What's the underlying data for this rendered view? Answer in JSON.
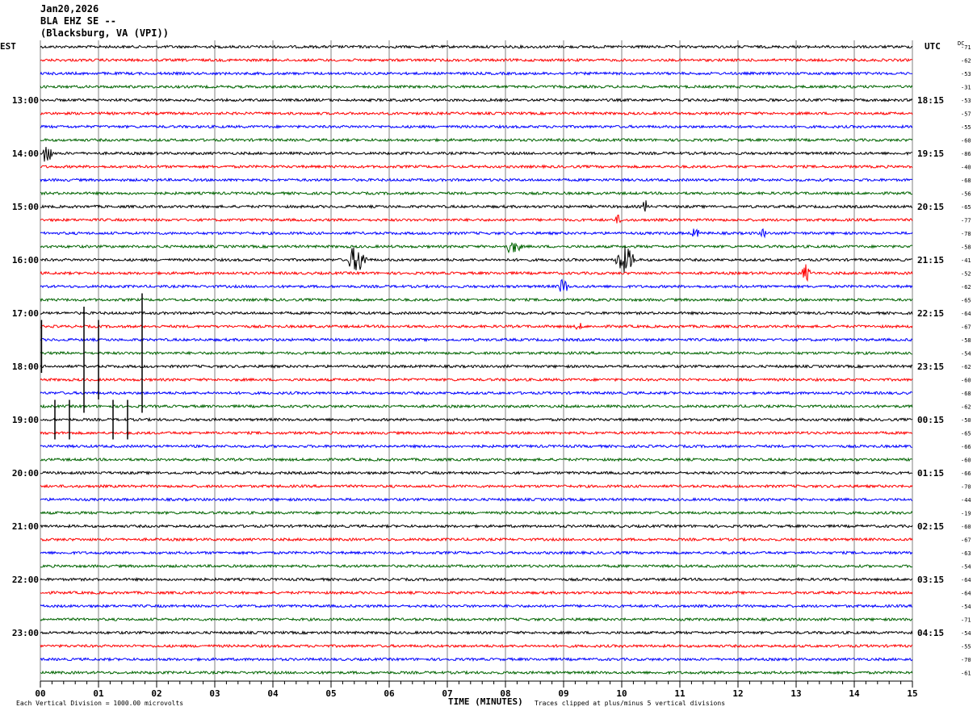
{
  "header": {
    "date": "Jan20,2026",
    "station": "BLA EHZ SE --",
    "location": "(Blacksburg, VA (VPI))"
  },
  "chart_data": {
    "type": "line",
    "subtype": "helicorder",
    "left_axis_label": "EST",
    "right_axis_label": "UTC",
    "dc_label": "DC",
    "xlabel": "TIME (MINUTES)",
    "xlim": [
      0,
      15
    ],
    "x_ticks": [
      "00",
      "01",
      "02",
      "03",
      "04",
      "05",
      "06",
      "07",
      "08",
      "09",
      "10",
      "11",
      "12",
      "13",
      "14",
      "15"
    ],
    "rows_per_hour": 4,
    "trace_colors": [
      "#000000",
      "#ff0000",
      "#0000ff",
      "#006400"
    ],
    "grid_color": "#808080",
    "est_labels": [
      "13:00",
      "14:00",
      "15:00",
      "16:00",
      "17:00",
      "18:00",
      "19:00",
      "20:00",
      "21:00",
      "22:00",
      "23:00"
    ],
    "utc_labels": [
      "18:15",
      "19:15",
      "20:15",
      "21:15",
      "22:15",
      "23:15",
      "00:15",
      "01:15",
      "02:15",
      "03:15",
      "04:15"
    ],
    "dc_offsets": [
      -71,
      -62,
      -53,
      -31,
      -53,
      -57,
      -55,
      -60,
      -86,
      -40,
      -68,
      -56,
      -65,
      -77,
      -78,
      -58,
      -41,
      -52,
      -62,
      -65,
      -64,
      -67,
      -58,
      -54,
      -62,
      -60,
      -68,
      -62,
      -50,
      -65,
      -66,
      -60,
      -66,
      -70,
      -44,
      -19,
      -60,
      -67,
      -63,
      -54,
      -64,
      -64,
      -54,
      -71,
      -54,
      -55,
      -70,
      -61
    ],
    "events": [
      {
        "row": 8,
        "start_min": 0.05,
        "end_min": 0.35,
        "amplitude": 5
      },
      {
        "row": 12,
        "start_min": 10.35,
        "end_min": 10.55,
        "amplitude": 3
      },
      {
        "row": 13,
        "start_min": 9.9,
        "end_min": 10.1,
        "amplitude": 2
      },
      {
        "row": 14,
        "start_min": 11.2,
        "end_min": 11.5,
        "amplitude": 2
      },
      {
        "row": 14,
        "start_min": 12.4,
        "end_min": 12.6,
        "amplitude": 2
      },
      {
        "row": 15,
        "start_min": 8.0,
        "end_min": 8.6,
        "amplitude": 2.5
      },
      {
        "row": 16,
        "start_min": 5.3,
        "end_min": 5.95,
        "amplitude": 5
      },
      {
        "row": 16,
        "start_min": 9.9,
        "end_min": 10.6,
        "amplitude": 5
      },
      {
        "row": 17,
        "start_min": 13.1,
        "end_min": 13.4,
        "amplitude": 3.5
      },
      {
        "row": 18,
        "start_min": 8.9,
        "end_min": 9.3,
        "amplitude": 3
      },
      {
        "row": 21,
        "start_min": 9.2,
        "end_min": 9.5,
        "amplitude": 1.5
      }
    ],
    "spikes": [
      {
        "minute": 0.02,
        "row_from": 21,
        "row_to": 24
      },
      {
        "minute": 0.25,
        "row_from": 27,
        "row_to": 29
      },
      {
        "minute": 0.5,
        "row_from": 27,
        "row_to": 29
      },
      {
        "minute": 0.75,
        "row_from": 20,
        "row_to": 27
      },
      {
        "minute": 1.0,
        "row_from": 21,
        "row_to": 26
      },
      {
        "minute": 1.25,
        "row_from": 27,
        "row_to": 29
      },
      {
        "minute": 1.5,
        "row_from": 27,
        "row_to": 29
      },
      {
        "minute": 1.75,
        "row_from": 19,
        "row_to": 27
      }
    ],
    "footer_left": "Each Vertical Division = 1000.00 microvolts",
    "footer_right": "Traces clipped at plus/minus 5 vertical divisions"
  }
}
